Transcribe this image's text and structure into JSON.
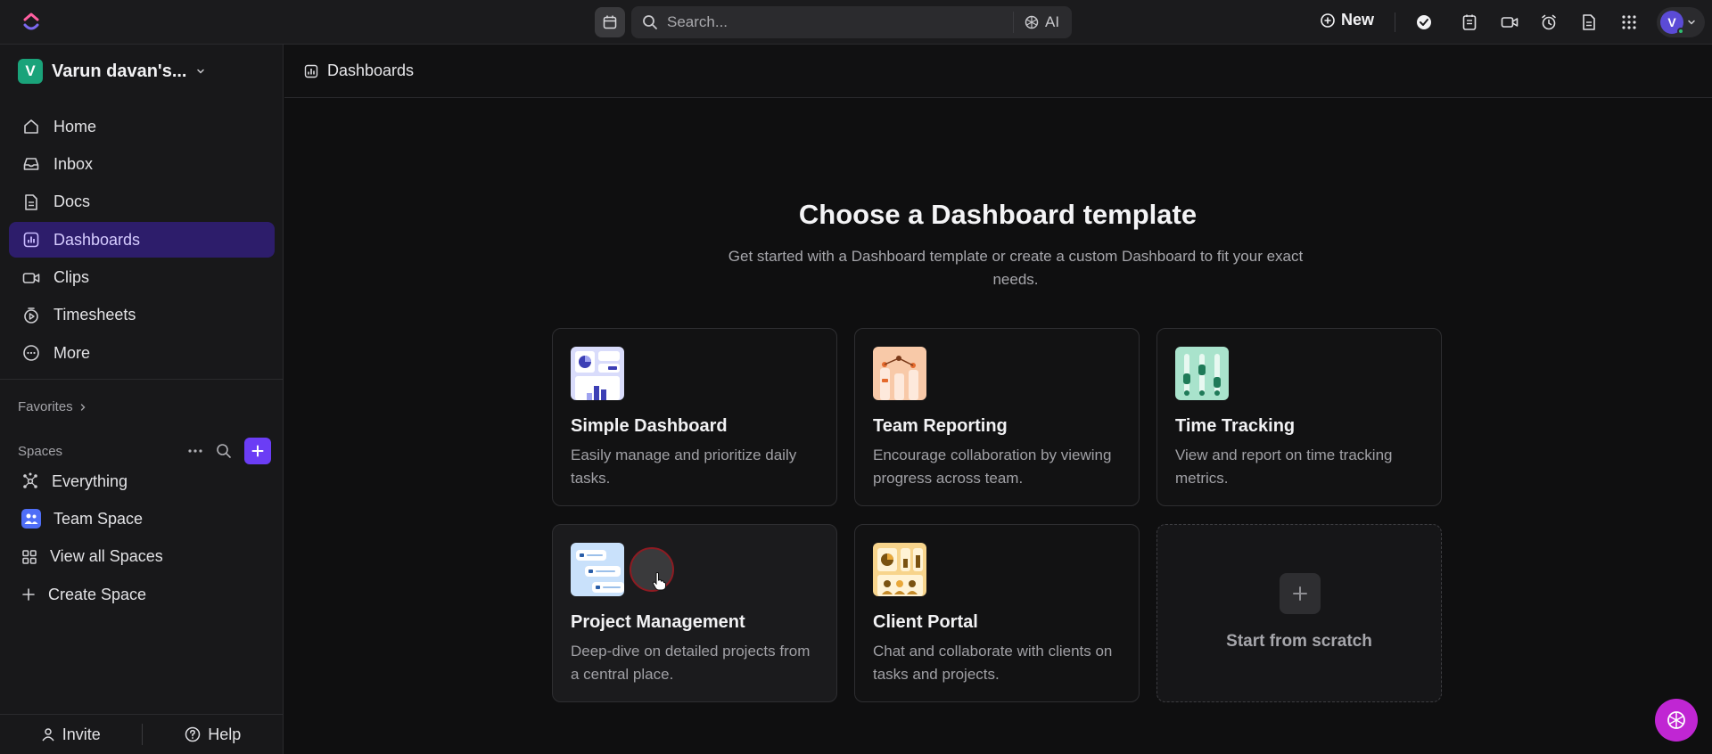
{
  "topbar": {
    "search_placeholder": "Search...",
    "ai_label": "AI",
    "new_label": "New",
    "avatar_initial": "V"
  },
  "sidebar": {
    "workspace_initial": "V",
    "workspace_name": "Varun davan's...",
    "nav": [
      {
        "label": "Home",
        "icon": "home-icon"
      },
      {
        "label": "Inbox",
        "icon": "inbox-icon"
      },
      {
        "label": "Docs",
        "icon": "docs-icon"
      },
      {
        "label": "Dashboards",
        "icon": "dashboards-icon",
        "active": true
      },
      {
        "label": "Clips",
        "icon": "clips-icon"
      },
      {
        "label": "Timesheets",
        "icon": "timesheets-icon"
      },
      {
        "label": "More",
        "icon": "more-icon"
      }
    ],
    "favorites_label": "Favorites",
    "spaces_label": "Spaces",
    "spaces": [
      {
        "label": "Everything",
        "icon": "everything-icon"
      },
      {
        "label": "Team Space",
        "icon": "team-space-icon"
      },
      {
        "label": "View all Spaces",
        "icon": "grid-icon"
      },
      {
        "label": "Create Space",
        "icon": "plus-icon"
      }
    ],
    "invite_label": "Invite",
    "help_label": "Help"
  },
  "main": {
    "breadcrumb": "Dashboards",
    "title": "Choose a Dashboard template",
    "subtitle": "Get started with a Dashboard template or create a custom Dashboard to fit your exact needs.",
    "cards": [
      {
        "title": "Simple Dashboard",
        "desc": "Easily manage and prioritize daily tasks."
      },
      {
        "title": "Team Reporting",
        "desc": "Encourage collaboration by viewing progress across team."
      },
      {
        "title": "Time Tracking",
        "desc": "View and report on time tracking metrics."
      },
      {
        "title": "Project Management",
        "desc": "Deep-dive on detailed projects from a central place."
      },
      {
        "title": "Client Portal",
        "desc": "Chat and collaborate with clients on tasks and projects."
      }
    ],
    "scratch_label": "Start from scratch"
  },
  "colors": {
    "accent": "#6b3df5",
    "active_nav_bg": "#2d1d6b",
    "fab": "#c026d3"
  }
}
